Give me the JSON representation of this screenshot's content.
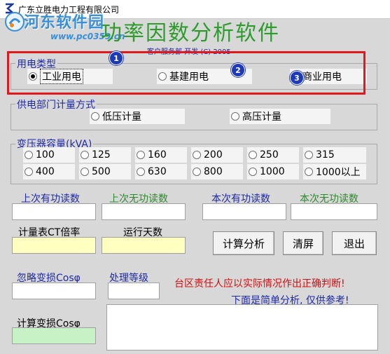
{
  "window": {
    "title": "广东立胜电力工程有限公司"
  },
  "watermark": {
    "name": "河东软件园",
    "url": "www.pc0359.cn"
  },
  "header": {
    "app_title": "功率因数分析软件",
    "subtitle": "客户服务部 开发 (C) 2005"
  },
  "usage_type": {
    "title": "用电类型",
    "options": [
      "工业用电",
      "基建用电",
      "商业用电"
    ],
    "selected": "工业用电"
  },
  "metering": {
    "title": "供电部门计量方式",
    "options": [
      "低压计量",
      "高压计量"
    ]
  },
  "transformer": {
    "title": "变压器容量(kVA)",
    "options": [
      "100",
      "125",
      "160",
      "200",
      "250",
      "315",
      "400",
      "500",
      "630",
      "800",
      "1000",
      "1000以上"
    ]
  },
  "readings": {
    "last_active": "上次有功读数",
    "last_reactive": "上次无功读数",
    "current_active": "本次有功读数",
    "current_reactive": "本次无功读数",
    "ct_ratio": "计量表CT倍率",
    "run_days": "运行天数",
    "ignore_cos": "忽略变损Cosφ",
    "level": "处理等级",
    "calc_cos": "计算变损Cosφ"
  },
  "buttons": {
    "analyze": "计算分析",
    "clear": "清屏",
    "exit": "退出"
  },
  "notes": {
    "line1": "台区责任人应以实际情况作出正确判断!",
    "line2": "下面是简单分析, 仅供参考!"
  },
  "badges": [
    "1",
    "2",
    "3"
  ],
  "colors": {
    "title_green": "#2d9c2d",
    "label_blue": "#1e2aa8",
    "warning_red": "#d01010",
    "highlight_red": "#e0191e",
    "badge_blue": "#1e3ab8"
  }
}
